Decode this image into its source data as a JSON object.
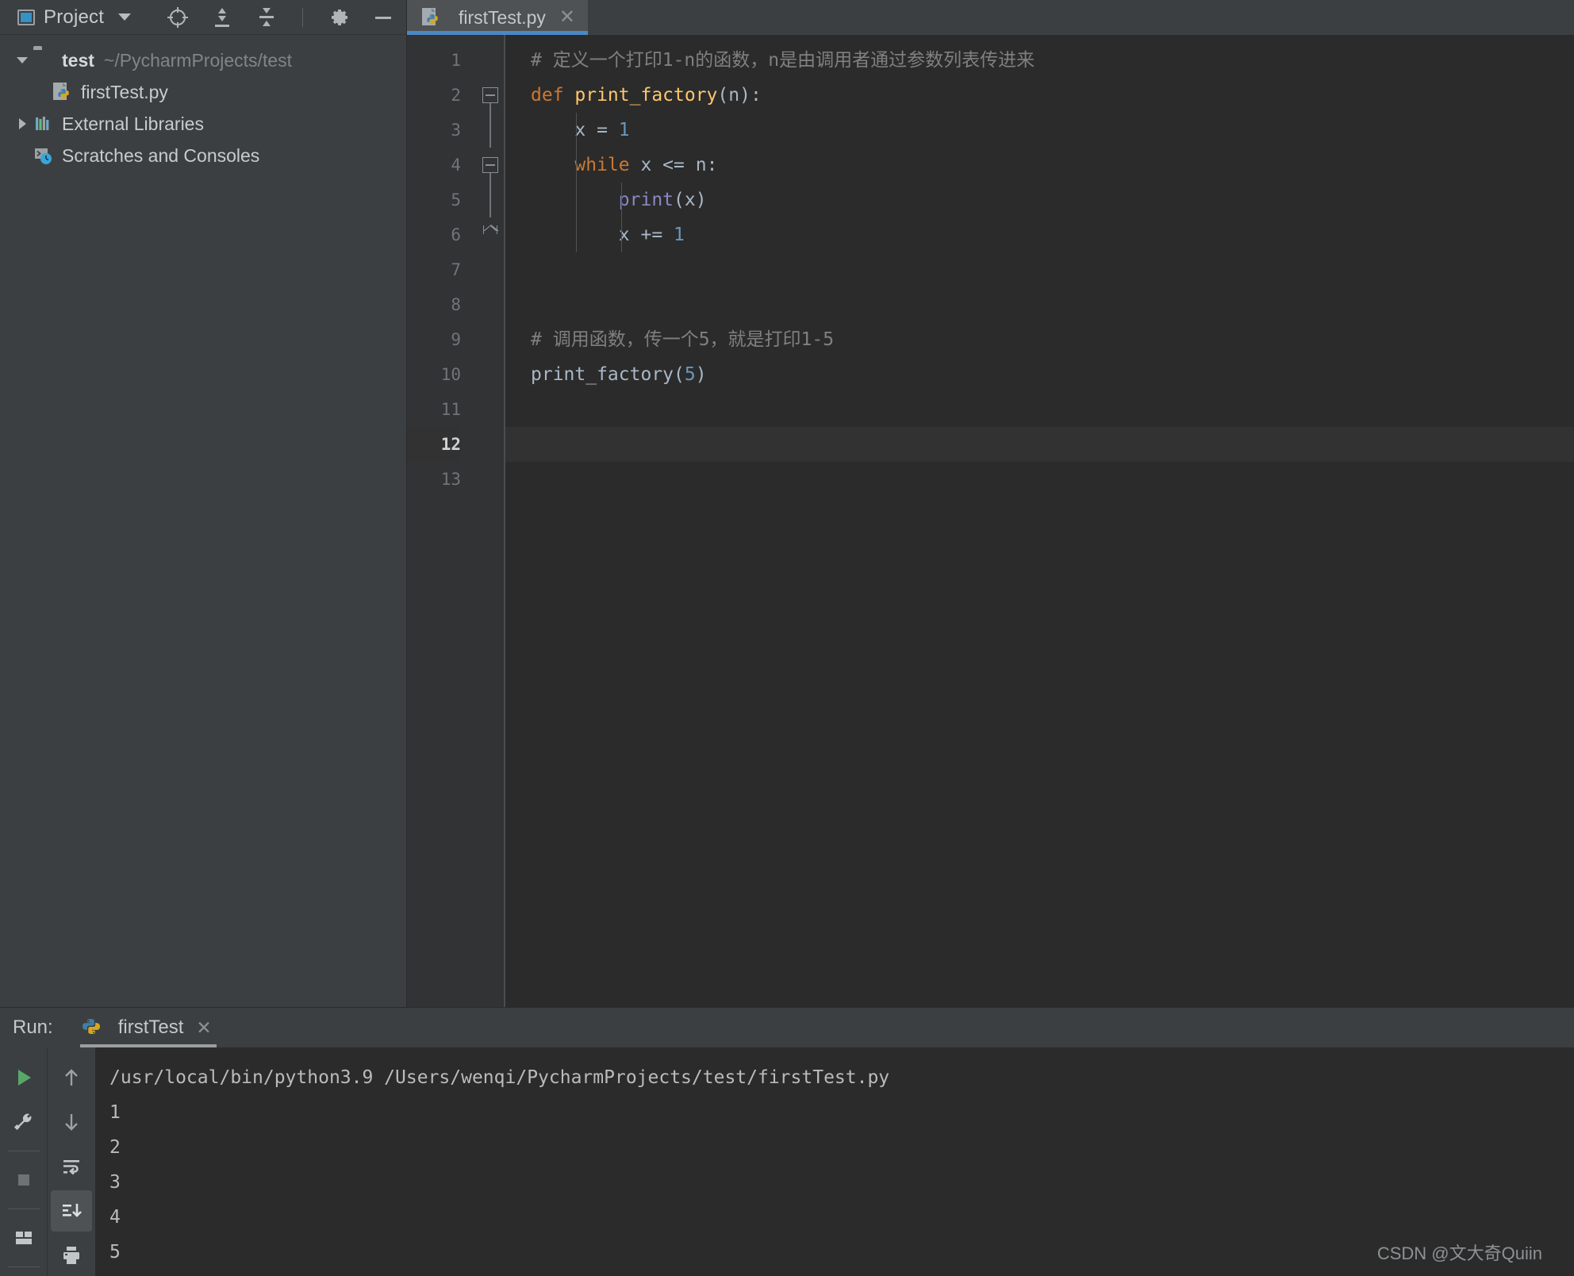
{
  "sidebar": {
    "header": {
      "title": "Project",
      "dropdown_icon": "chevron-down-icon",
      "icons": [
        {
          "name": "locate-target-icon",
          "label": "Select Opened File"
        },
        {
          "name": "expand-all-icon",
          "label": "Expand All"
        },
        {
          "name": "collapse-all-icon",
          "label": "Collapse All"
        },
        {
          "name": "gear-icon",
          "label": "Settings"
        },
        {
          "name": "minimize-icon",
          "label": "Hide"
        }
      ]
    },
    "tree": [
      {
        "name": "test",
        "path": "~/PycharmProjects/test",
        "icon": "folder-icon",
        "expanded": true,
        "arrow": "chevron-down-icon"
      },
      {
        "name": "firstTest.py",
        "path": "",
        "icon": "python-file-icon",
        "expanded": false,
        "arrow": "none"
      },
      {
        "name": "External Libraries",
        "path": "",
        "icon": "libraries-icon",
        "expanded": false,
        "arrow": "chevron-right-icon"
      },
      {
        "name": "Scratches and Consoles",
        "path": "",
        "icon": "scratches-icon",
        "expanded": false,
        "arrow": "none"
      }
    ]
  },
  "editor": {
    "tab": {
      "title": "firstTest.py",
      "icon": "python-file-icon",
      "close_icon": "close-icon",
      "active": true
    },
    "caret_line": 12,
    "total_lines": 13,
    "lines": [
      {
        "num": 1,
        "segments": [
          {
            "t": "# 定义一个打印1-n的函数，n是由调用者通过参数列表传进来",
            "c": "comment"
          }
        ]
      },
      {
        "num": 2,
        "segments": [
          {
            "t": "def ",
            "c": "kw"
          },
          {
            "t": "print_factory",
            "c": "fn"
          },
          {
            "t": "(n):",
            "c": "plain"
          }
        ]
      },
      {
        "num": 3,
        "segments": [
          {
            "t": "    x = ",
            "c": "plain"
          },
          {
            "t": "1",
            "c": "num"
          }
        ]
      },
      {
        "num": 4,
        "segments": [
          {
            "t": "    ",
            "c": "plain"
          },
          {
            "t": "while",
            "c": "kw"
          },
          {
            "t": " x <= n:",
            "c": "plain"
          }
        ]
      },
      {
        "num": 5,
        "segments": [
          {
            "t": "        ",
            "c": "plain"
          },
          {
            "t": "print",
            "c": "builtin"
          },
          {
            "t": "(x)",
            "c": "plain"
          }
        ]
      },
      {
        "num": 6,
        "segments": [
          {
            "t": "        x += ",
            "c": "plain"
          },
          {
            "t": "1",
            "c": "num"
          }
        ]
      },
      {
        "num": 7,
        "segments": []
      },
      {
        "num": 8,
        "segments": []
      },
      {
        "num": 9,
        "segments": [
          {
            "t": "# 调用函数，传一个5，就是打印1-5",
            "c": "comment"
          }
        ]
      },
      {
        "num": 10,
        "segments": [
          {
            "t": "print_factory(",
            "c": "plain"
          },
          {
            "t": "5",
            "c": "num"
          },
          {
            "t": ")",
            "c": "plain"
          }
        ]
      },
      {
        "num": 11,
        "segments": []
      },
      {
        "num": 12,
        "segments": []
      },
      {
        "num": 13,
        "segments": []
      }
    ]
  },
  "run_panel": {
    "label": "Run:",
    "tab": {
      "title": "firstTest",
      "icon": "python-icon",
      "close_icon": "close-icon"
    },
    "toolbar_left": [
      {
        "name": "run-button",
        "icon": "play-icon"
      },
      {
        "name": "debug-settings-button",
        "icon": "wrench-icon"
      },
      {
        "name": "stop-button",
        "icon": "stop-square-icon"
      },
      {
        "name": "layout-button",
        "icon": "layout-icon"
      }
    ],
    "toolbar_right": [
      {
        "name": "up-button",
        "icon": "arrow-up-icon"
      },
      {
        "name": "down-button",
        "icon": "arrow-down-icon"
      },
      {
        "name": "soft-wrap-button",
        "icon": "soft-wrap-icon"
      },
      {
        "name": "scroll-to-end-button",
        "icon": "scroll-end-icon",
        "selected": true
      },
      {
        "name": "print-button",
        "icon": "printer-icon"
      }
    ],
    "console": {
      "command": "/usr/local/bin/python3.9 /Users/wenqi/PycharmProjects/test/firstTest.py",
      "output": [
        "1",
        "2",
        "3",
        "4",
        "5"
      ]
    }
  },
  "watermark": "CSDN @文大奇Quiin",
  "colors": {
    "accent_blue": "#4a88c7",
    "keyword_orange": "#cc7832",
    "number_blue": "#6897bb",
    "function_yellow": "#ffc66d",
    "builtin_purple": "#8888c6",
    "comment_gray": "#808080",
    "editor_bg": "#2b2b2b",
    "panel_bg": "#3c3f41"
  }
}
